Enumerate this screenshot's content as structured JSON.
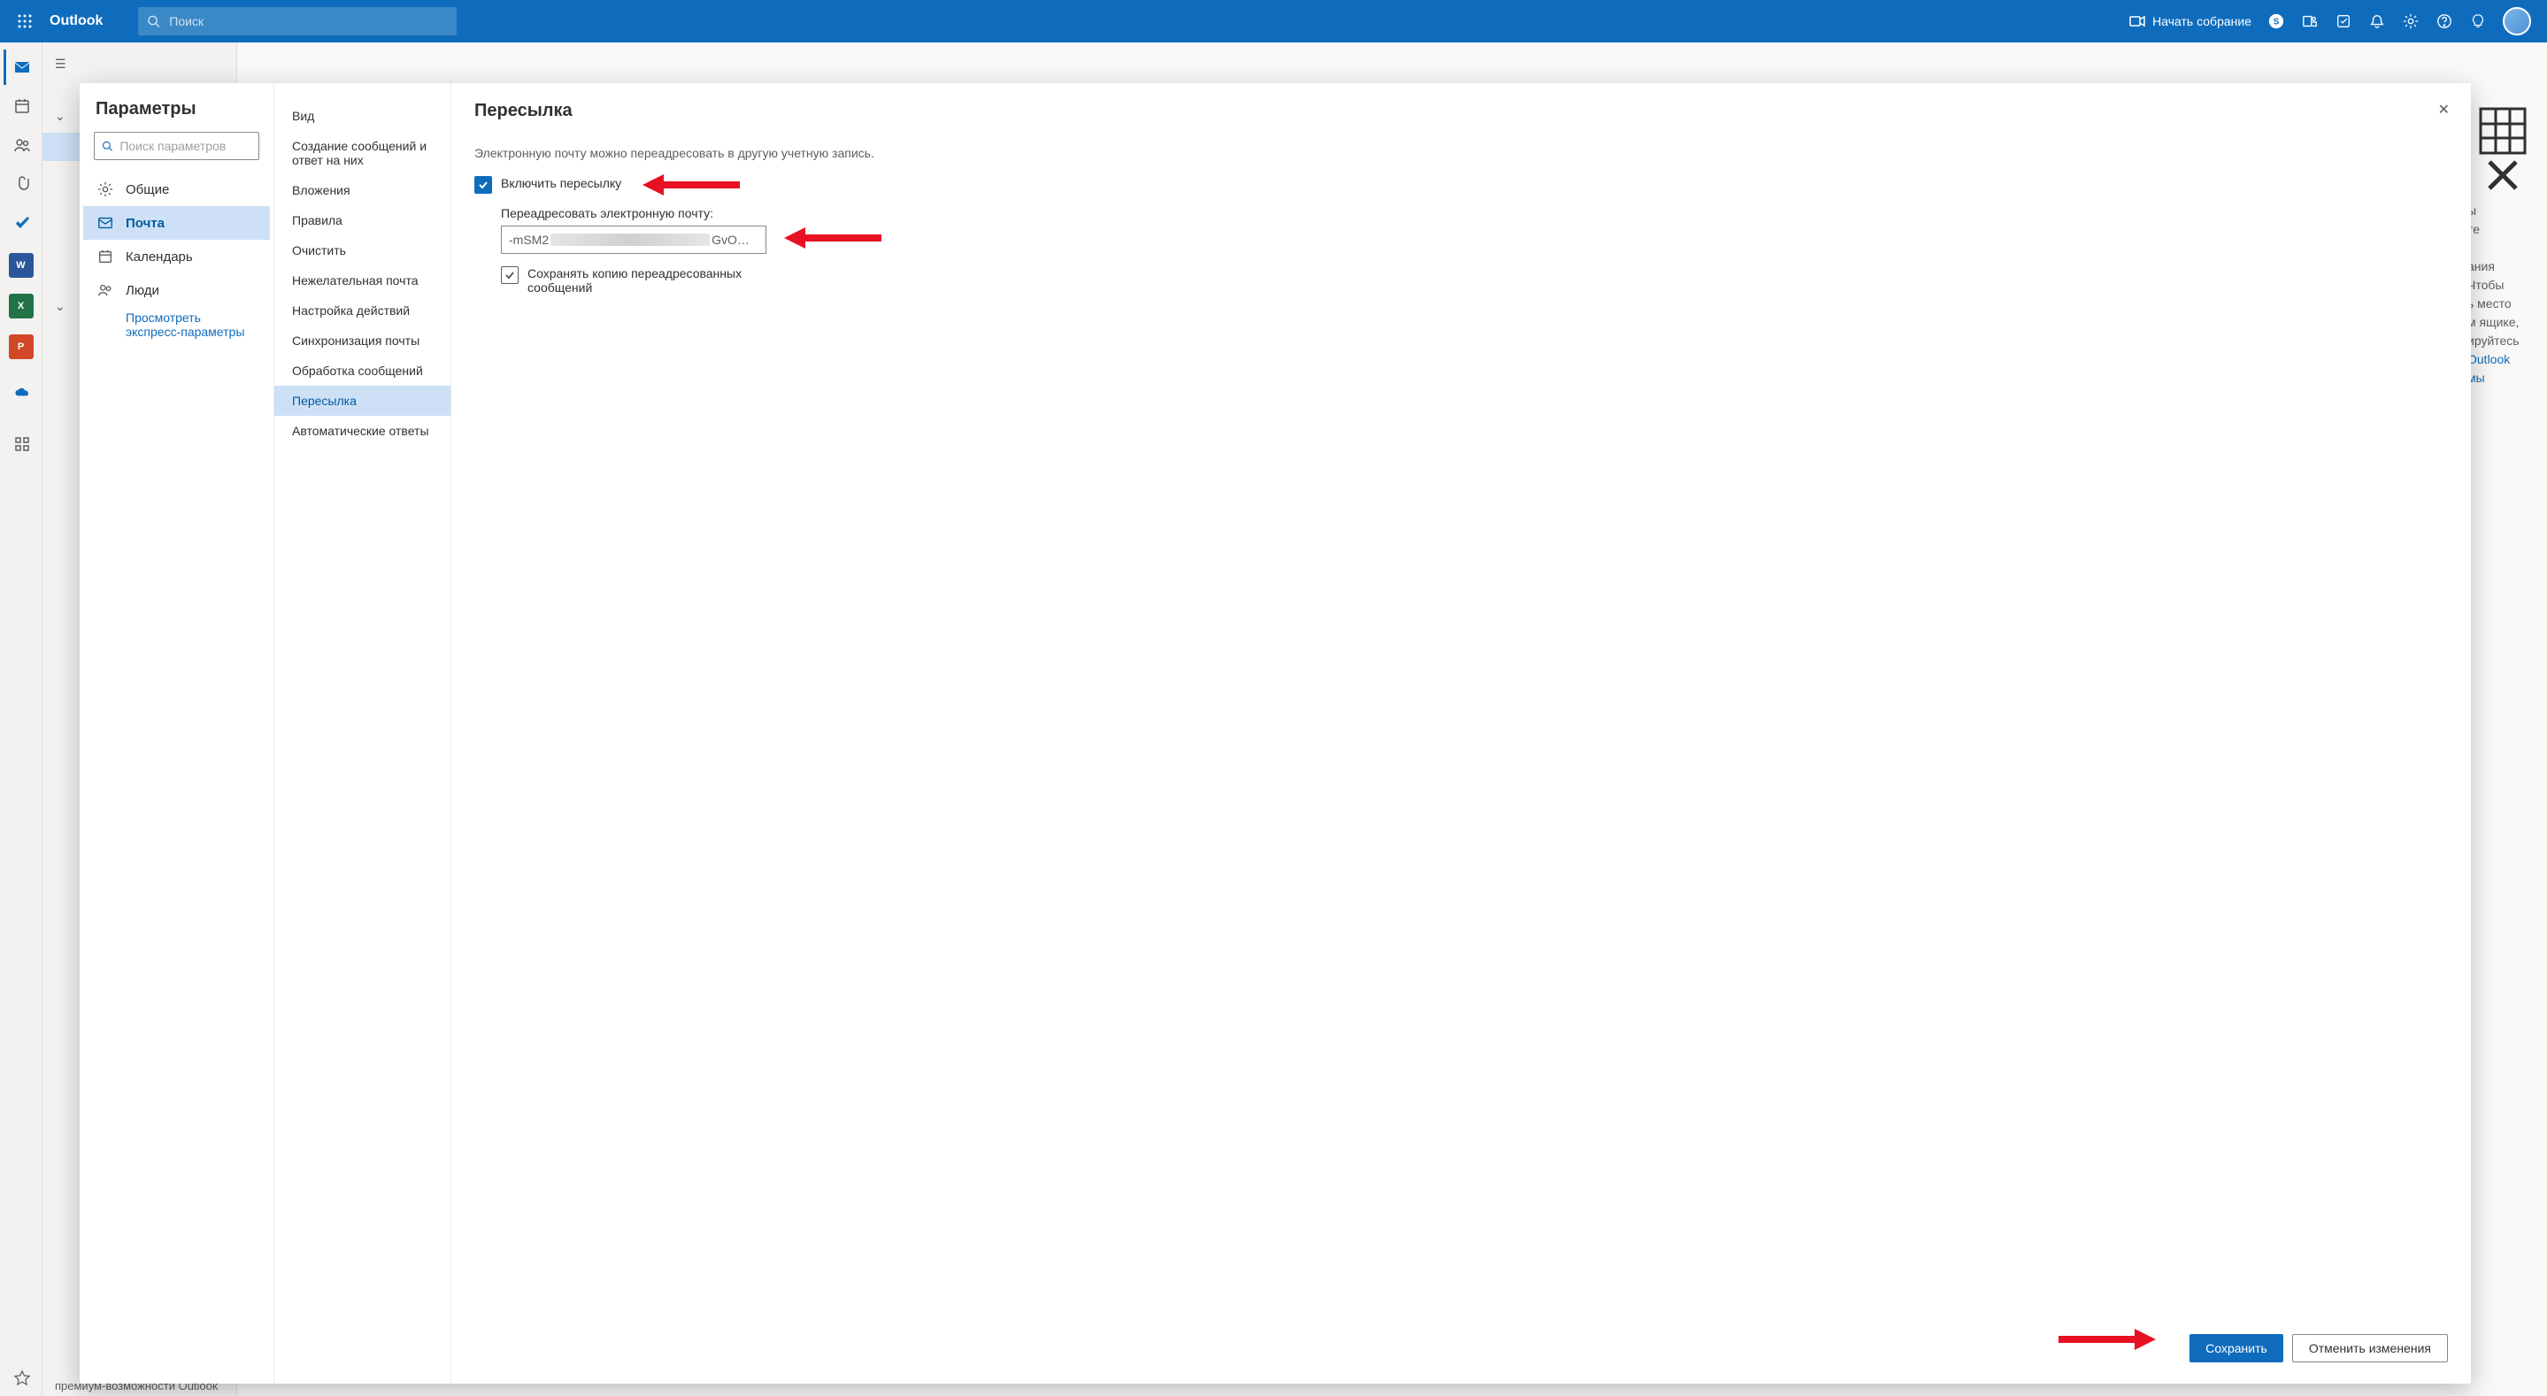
{
  "header": {
    "brand": "Outlook",
    "search_placeholder": "Поиск",
    "meet_label": "Начать собрание"
  },
  "left_panel": {
    "premium_note": "премиум-возможности Outlook"
  },
  "reading_fragment": {
    "lines": [
      "ы",
      "те",
      "ания",
      "Чтобы",
      "ь место",
      "м ящике,",
      "ируйтесь"
    ],
    "link1": "Outlook",
    "link2": "мы"
  },
  "modal": {
    "title": "Параметры",
    "search_placeholder": "Поиск параметров",
    "categories": [
      {
        "icon": "gear",
        "label": "Общие"
      },
      {
        "icon": "mail",
        "label": "Почта"
      },
      {
        "icon": "calendar",
        "label": "Календарь"
      },
      {
        "icon": "people",
        "label": "Люди"
      }
    ],
    "quick_settings_link": "Просмотреть экспресс-параметры",
    "subnav": [
      "Вид",
      "Создание сообщений и ответ на них",
      "Вложения",
      "Правила",
      "Очистить",
      "Нежелательная почта",
      "Настройка действий",
      "Синхронизация почты",
      "Обработка сообщений",
      "Пересылка",
      "Автоматические ответы"
    ],
    "subnav_selected_index": 9,
    "pane": {
      "heading": "Пересылка",
      "description": "Электронную почту можно переадресовать в другую учетную запись.",
      "enable_label": "Включить пересылку",
      "forward_to_label": "Переадресовать электронную почту:",
      "forward_value_prefix": "-mSM2",
      "forward_value_suffix": "GvO…",
      "keep_copy_label": "Сохранять копию переадресованных сообщений"
    },
    "footer": {
      "save": "Сохранить",
      "cancel": "Отменить изменения"
    }
  }
}
